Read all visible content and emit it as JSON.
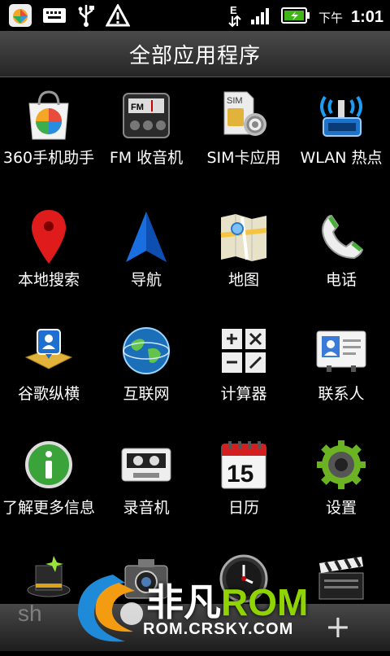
{
  "status": {
    "ampm": "下午",
    "time": "1:01",
    "left_icons": [
      "app-store-icon",
      "keyboard-icon",
      "usb-icon",
      "warning-icon"
    ],
    "right_icons": [
      "data-e-icon",
      "signal-icon",
      "battery-charging-icon"
    ]
  },
  "title": "全部应用程序",
  "apps": [
    {
      "label": "360手机助手",
      "icon": "app-store-bag-icon"
    },
    {
      "label": "FM 收音机",
      "icon": "radio-icon"
    },
    {
      "label": "SIM卡应用",
      "icon": "sim-card-gear-icon"
    },
    {
      "label": "WLAN 热点",
      "icon": "wifi-hotspot-icon"
    },
    {
      "label": "本地搜索",
      "icon": "map-pin-icon"
    },
    {
      "label": "导航",
      "icon": "navigation-arrow-icon"
    },
    {
      "label": "地图",
      "icon": "map-icon"
    },
    {
      "label": "电话",
      "icon": "phone-icon"
    },
    {
      "label": "谷歌纵横",
      "icon": "latitude-icon"
    },
    {
      "label": "互联网",
      "icon": "globe-icon"
    },
    {
      "label": "计算器",
      "icon": "calculator-icon"
    },
    {
      "label": "联系人",
      "icon": "contacts-card-icon"
    },
    {
      "label": "了解更多信息",
      "icon": "info-icon"
    },
    {
      "label": "录音机",
      "icon": "cassette-icon"
    },
    {
      "label": "日历",
      "icon": "calendar-icon"
    },
    {
      "label": "设置",
      "icon": "settings-gear-icon"
    },
    {
      "label": "",
      "icon": "magic-hat-icon"
    },
    {
      "label": "",
      "icon": "camera-icon"
    },
    {
      "label": "",
      "icon": "clock-icon"
    },
    {
      "label": "",
      "icon": "movie-clapper-icon"
    }
  ],
  "calendar_day": "15",
  "watermark": {
    "brand_prefix": "非凡",
    "brand_suffix": "ROM",
    "url": "ROM.CRSKY.COM",
    "corner_text": "sh"
  }
}
